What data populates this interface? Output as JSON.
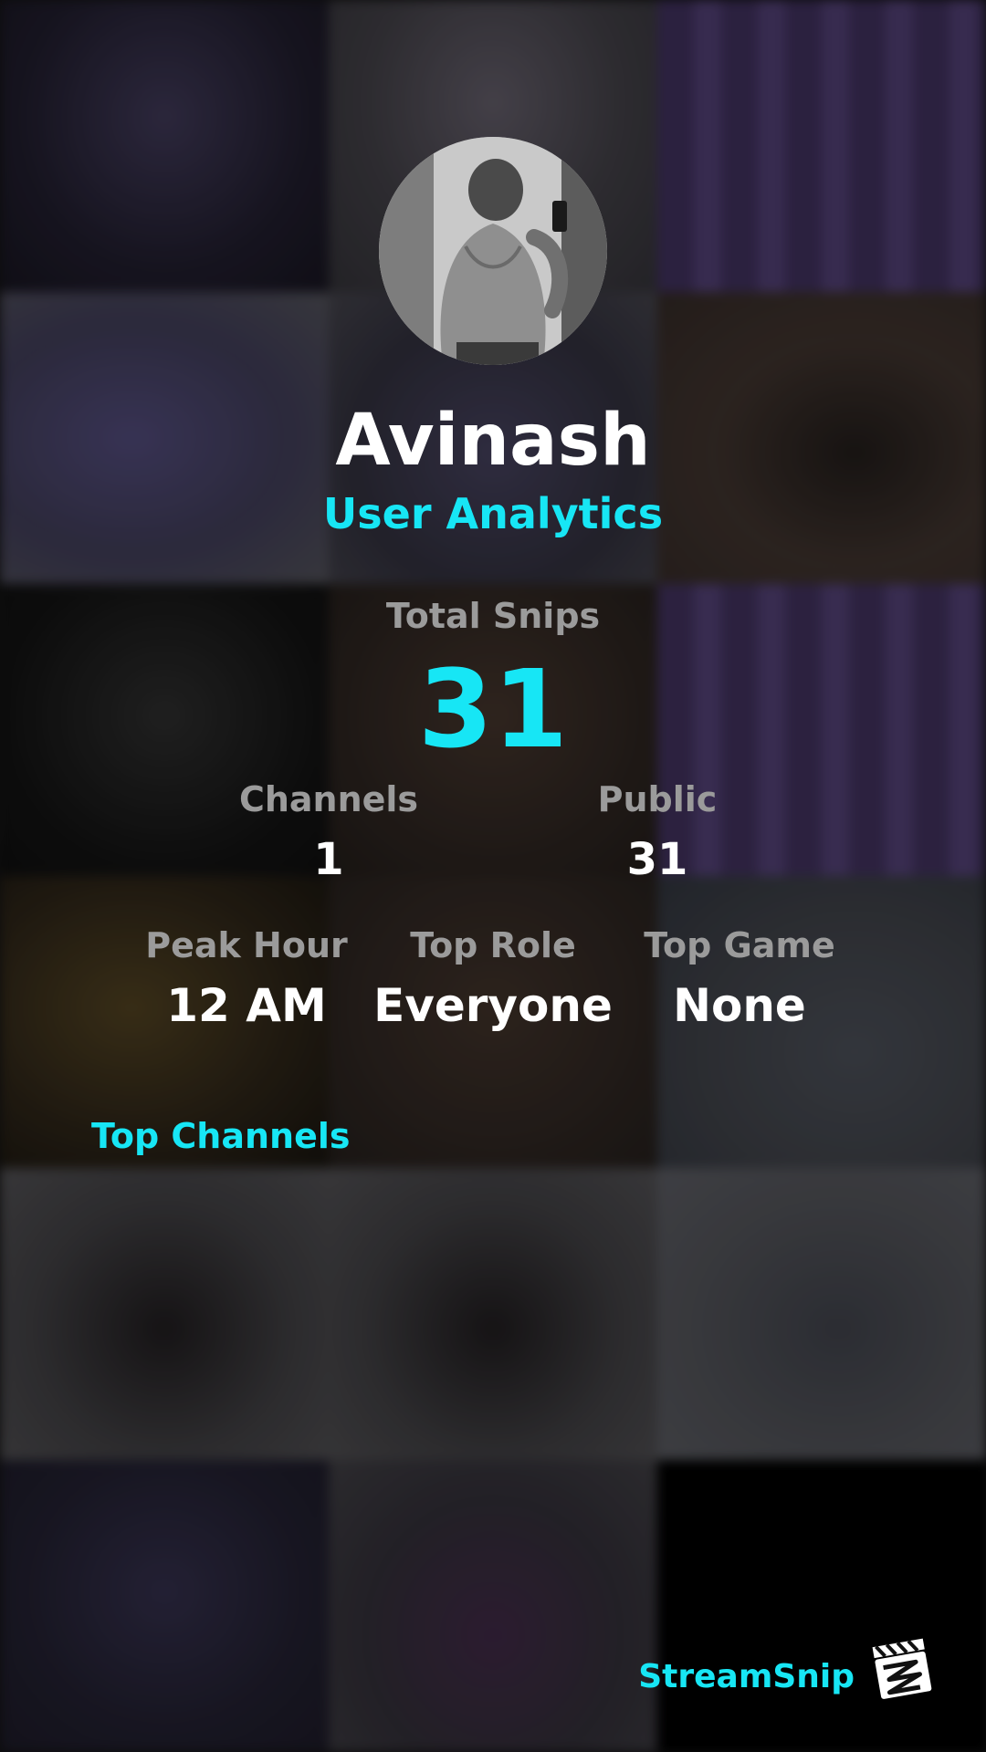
{
  "profile": {
    "name": "Avinash",
    "subtitle": "User Analytics",
    "avatar_icon": "profile-photo"
  },
  "stats": {
    "total_snips_label": "Total Snips",
    "total_snips_value": "31",
    "channels_label": "Channels",
    "channels_value": "1",
    "public_label": "Public",
    "public_value": "31",
    "peak_hour_label": "Peak Hour",
    "peak_hour_value": "12 AM",
    "top_role_label": "Top Role",
    "top_role_value": "Everyone",
    "top_game_label": "Top Game",
    "top_game_value": "None"
  },
  "sections": {
    "top_channels_title": "Top Channels"
  },
  "brand": {
    "name": "StreamSnip",
    "logo_icon": "clapperboard-icon"
  },
  "colors": {
    "accent": "#17e6f5",
    "text_primary": "#ffffff",
    "text_muted": "#9b9b9b"
  }
}
